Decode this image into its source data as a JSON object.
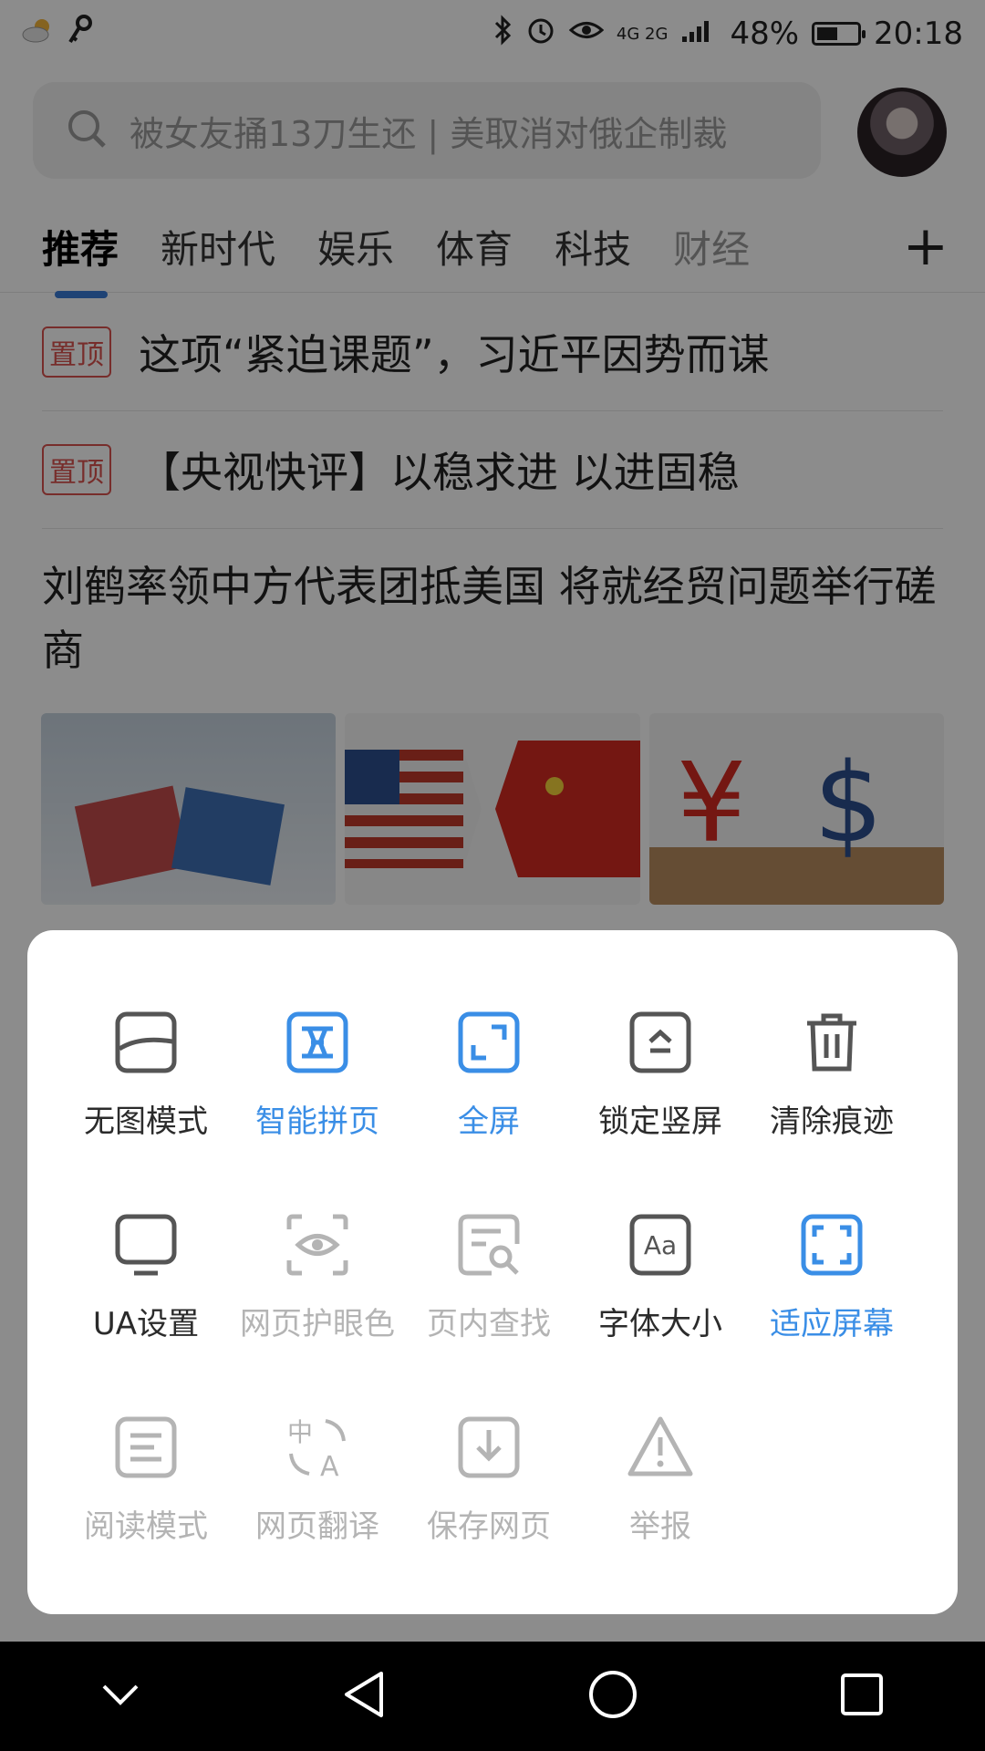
{
  "status_bar": {
    "network": "4G 2G",
    "battery": "48%",
    "time": "20:18"
  },
  "search": {
    "placeholder": "被女友捅13刀生还 | 美取消对俄企制裁"
  },
  "tabs": [
    {
      "label": "推荐"
    },
    {
      "label": "新时代"
    },
    {
      "label": "娱乐"
    },
    {
      "label": "体育"
    },
    {
      "label": "科技"
    },
    {
      "label": "财经"
    }
  ],
  "news": {
    "items": [
      {
        "badge": "置顶",
        "title": "这项“紧迫课题”，习近平因势而谋"
      },
      {
        "badge": "置顶",
        "title": "【央视快评】以稳求进 以进固稳"
      }
    ],
    "headline": "刘鹤率领中方代表团抵美国 将就经贸问题举行磋商"
  },
  "menu": {
    "items": [
      {
        "label": "无图模式",
        "icon": "no-image-icon",
        "state": "normal"
      },
      {
        "label": "智能拼页",
        "icon": "smart-page-icon",
        "state": "active"
      },
      {
        "label": "全屏",
        "icon": "fullscreen-icon",
        "state": "active"
      },
      {
        "label": "锁定竖屏",
        "icon": "lock-portrait-icon",
        "state": "normal"
      },
      {
        "label": "清除痕迹",
        "icon": "trash-icon",
        "state": "normal"
      },
      {
        "label": "UA设置",
        "icon": "monitor-icon",
        "state": "normal"
      },
      {
        "label": "网页护眼色",
        "icon": "eye-protection-icon",
        "state": "disabled"
      },
      {
        "label": "页内查找",
        "icon": "find-in-page-icon",
        "state": "disabled"
      },
      {
        "label": "字体大小",
        "icon": "font-size-icon",
        "state": "normal"
      },
      {
        "label": "适应屏幕",
        "icon": "fit-screen-icon",
        "state": "active"
      },
      {
        "label": "阅读模式",
        "icon": "reading-mode-icon",
        "state": "disabled"
      },
      {
        "label": "网页翻译",
        "icon": "translate-icon",
        "state": "disabled"
      },
      {
        "label": "保存网页",
        "icon": "save-page-icon",
        "state": "disabled"
      },
      {
        "label": "举报",
        "icon": "report-icon",
        "state": "disabled"
      }
    ]
  },
  "colors": {
    "active": "#3a8ee6",
    "normal": "#2b2b2b",
    "disabled": "#b4b4b4",
    "badge": "#d9534f"
  }
}
